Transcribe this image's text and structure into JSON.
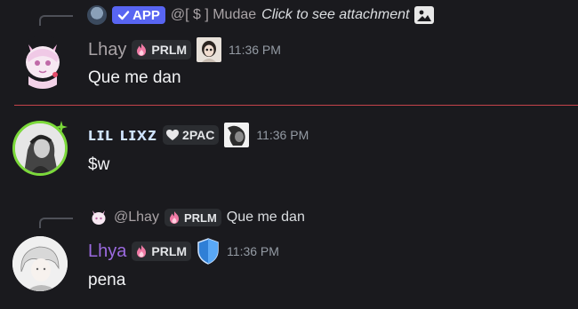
{
  "colors": {
    "background": "#1a1a1e",
    "app_badge": "#5865f2",
    "divider": "#c4434a",
    "user1_name": "#a9a3a6",
    "user3_name": "#9b6ae0"
  },
  "messages": [
    {
      "reply": {
        "app_badge": "APP",
        "author": "@[ $ ] Mudae",
        "text": "Click to see attachment"
      },
      "author": "Lhay",
      "tag": "PRLM",
      "timestamp": "11:36 PM",
      "content": "Que me dan"
    },
    {
      "author": "ʟɪʟ ʟɪxᴢ",
      "tag": "2PAC",
      "timestamp": "11:36 PM",
      "content": "$w"
    },
    {
      "reply": {
        "author": "@Lhay",
        "tag": "PRLM",
        "text": "Que me dan"
      },
      "author": "Lhya",
      "tag": "PRLM",
      "timestamp": "11:36 PM",
      "content": "pena"
    }
  ]
}
